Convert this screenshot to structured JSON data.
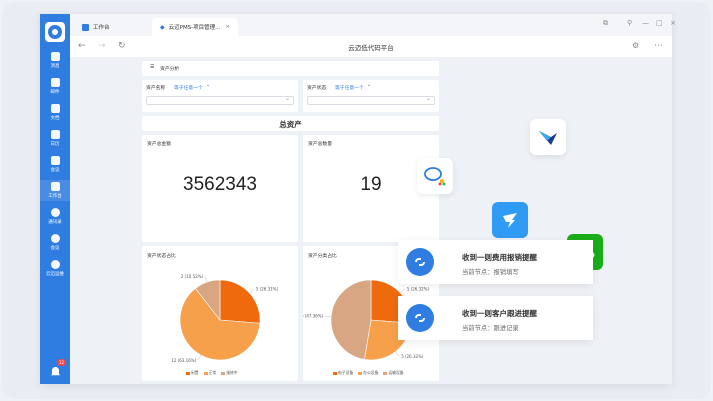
{
  "window": {
    "address_title": "云迈低代码平台"
  },
  "tabs": [
    {
      "label": "工作台"
    },
    {
      "label": "云迈PMS-项目管理..."
    }
  ],
  "sidebar": {
    "items": [
      {
        "label": "消息"
      },
      {
        "label": "邮件"
      },
      {
        "label": "文档"
      },
      {
        "label": "日历"
      },
      {
        "label": "会议"
      },
      {
        "label": "工作台"
      },
      {
        "label": "通讯录"
      },
      {
        "label": "会议"
      },
      {
        "label": "云迈运维"
      }
    ],
    "badge": "12"
  },
  "breadcrumb": "资产分析",
  "filters": [
    {
      "label": "资产名称",
      "link": "等于任意一个"
    },
    {
      "label": "资产状态",
      "link": "等于任意一个"
    }
  ],
  "section_title": "总资产",
  "kpis": [
    {
      "label": "资产总金额",
      "value": "3562343"
    },
    {
      "label": "资产总数量",
      "value": "19"
    }
  ],
  "charts": [
    {
      "label": "资产状态占比",
      "legend": [
        "闲置",
        "正常",
        "维修中"
      ]
    },
    {
      "label": "资产分类占比",
      "legend": [
        "电子设备",
        "办公设备",
        "运输设备"
      ]
    }
  ],
  "chart_data": [
    {
      "type": "pie",
      "title": "资产状态占比",
      "categories": [
        "闲置",
        "正常",
        "维修中"
      ],
      "values": [
        5,
        12,
        2
      ],
      "labels": [
        "5 (26.31%)",
        "12 (63.16%)",
        "2 (10.53%)"
      ],
      "colors": [
        "#ef6a0d",
        "#f7a04b",
        "#d9a684"
      ]
    },
    {
      "type": "pie",
      "title": "资产分类占比",
      "categories": [
        "电子设备",
        "办公设备",
        "运输设备"
      ],
      "values": [
        5,
        5,
        9
      ],
      "labels": [
        "5 (26.32%)",
        "5 (26.32%)",
        "9 (47.36%)"
      ],
      "colors": [
        "#ef6a0d",
        "#f7a04b",
        "#d9a684"
      ]
    }
  ],
  "notifications": [
    {
      "title": "收到一则费用报销提醒",
      "sub": "当前节点：报销填写"
    },
    {
      "title": "收到一则客户跟进提醒",
      "sub": "当前节点：跟进记录"
    }
  ]
}
